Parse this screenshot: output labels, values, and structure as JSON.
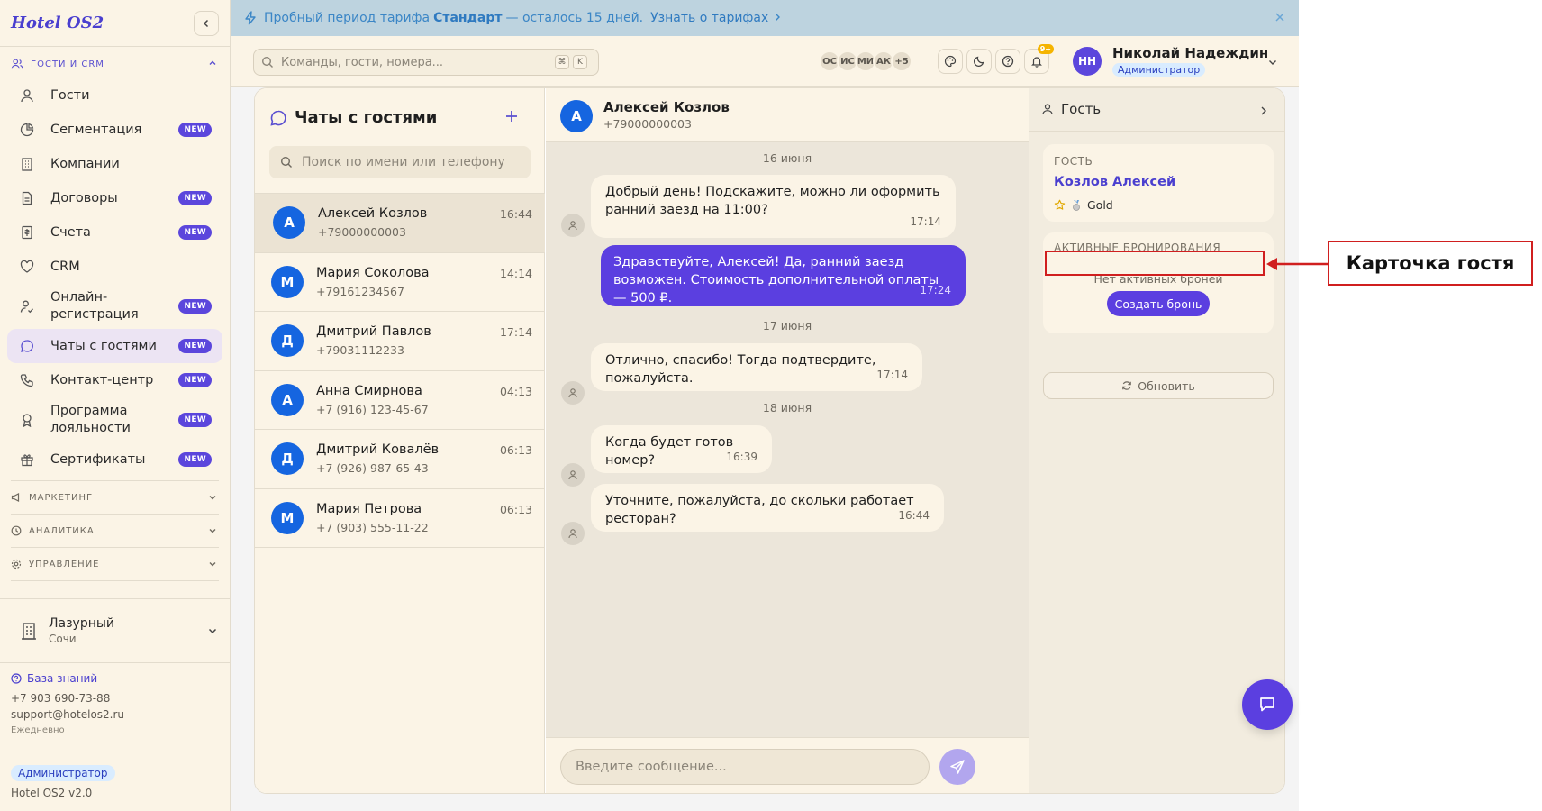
{
  "brand": "Hotel OS2",
  "sidebar": {
    "section_guests": "ГОСТИ И CRM",
    "items": [
      {
        "label": "Гости",
        "icon": "users-icon",
        "new": false
      },
      {
        "label": "Сегментация",
        "icon": "pie-chart-icon",
        "new": true
      },
      {
        "label": "Компании",
        "icon": "building-icon",
        "new": false
      },
      {
        "label": "Договоры",
        "icon": "document-icon",
        "new": true
      },
      {
        "label": "Счета",
        "icon": "invoice-icon",
        "new": true
      },
      {
        "label": "CRM",
        "icon": "heart-icon",
        "new": false
      },
      {
        "label": "Онлайн-регистрация",
        "icon": "user-check-icon",
        "new": true
      },
      {
        "label": "Чаты с гостями",
        "icon": "chat-icon",
        "new": true,
        "active": true
      },
      {
        "label": "Контакт-центр",
        "icon": "phone-icon",
        "new": true
      },
      {
        "label": "Программа лояльности",
        "icon": "award-icon",
        "new": true
      },
      {
        "label": "Сертификаты",
        "icon": "gift-icon",
        "new": true
      }
    ],
    "new_badge": "NEW",
    "section_marketing": "МАРКЕТИНГ",
    "section_analytics": "АНАЛИТИКА",
    "section_management": "УПРАВЛЕНИЕ",
    "hotel_name": "Лазурный",
    "hotel_city": "Сочи",
    "kb_link": "База знаний",
    "phone": "+7 903 690-73-88",
    "email": "support@hotelos2.ru",
    "schedule": "Ежедневно",
    "role": "Администратор",
    "version": "Hotel OS2 v2.0"
  },
  "banner": {
    "text_before": "Пробный период тарифа",
    "plan": "Стандарт",
    "text_after": "— осталось 15 дней.",
    "link": "Узнать о тарифах"
  },
  "header": {
    "search_placeholder": "Команды, гости, номера...",
    "kbd1": "⌘",
    "kbd2": "K",
    "presence": [
      "ОС",
      "ИС",
      "МИ",
      "АК",
      "+5"
    ],
    "notif_count": "9+",
    "user_initials": "НН",
    "user_name": "Николай Надеждин",
    "user_role": "Администратор"
  },
  "chat_list": {
    "title": "Чаты с гостями",
    "search_placeholder": "Поиск по имени или телефону",
    "chats": [
      {
        "initial": "А",
        "name": "Алексей Козлов",
        "phone": "+79000000003",
        "time": "16:44",
        "active": true
      },
      {
        "initial": "М",
        "name": "Мария Соколова",
        "phone": "+79161234567",
        "time": "14:14"
      },
      {
        "initial": "Д",
        "name": "Дмитрий Павлов",
        "phone": "+79031112233",
        "time": "17:14"
      },
      {
        "initial": "А",
        "name": "Анна Смирнова",
        "phone": "+7 (916) 123-45-67",
        "time": "04:13"
      },
      {
        "initial": "Д",
        "name": "Дмитрий Ковалёв",
        "phone": "+7 (926) 987-65-43",
        "time": "06:13"
      },
      {
        "initial": "М",
        "name": "Мария Петрова",
        "phone": "+7 (903) 555-11-22",
        "time": "06:13"
      }
    ]
  },
  "conversation": {
    "initial": "А",
    "name": "Алексей Козлов",
    "phone": "+79000000003",
    "dates": [
      "16 июня",
      "17 июня",
      "18 июня"
    ],
    "messages": [
      {
        "text": "Добрый день! Подскажите, можно ли оформить ранний заезд на 11:00?",
        "time": "17:14",
        "dir": "in"
      },
      {
        "text": "Здравствуйте, Алексей! Да, ранний заезд возможен. Стоимость дополнительной оплаты — 500 ₽.",
        "time": "17:24",
        "dir": "out"
      },
      {
        "text": "Отлично, спасибо! Тогда подтвердите, пожалуйста.",
        "time": "17:14",
        "dir": "in"
      },
      {
        "text": "Когда будет готов номер?",
        "time": "16:39",
        "dir": "in"
      },
      {
        "text": "Уточните, пожалуйста, до скольки работает ресторан?",
        "time": "16:44",
        "dir": "in"
      }
    ],
    "input_placeholder": "Введите сообщение..."
  },
  "guest_panel": {
    "title": "Гость",
    "label_guest": "ГОСТЬ",
    "guest_name": "Козлов Алексей",
    "tier": "Gold",
    "label_bookings": "АКТИВНЫЕ БРОНИРОВАНИЯ",
    "no_bookings": "Нет активных броней",
    "create_button": "Создать бронь",
    "refresh_button": "Обновить"
  },
  "annotation": {
    "callout": "Карточка гостя",
    "color": "#d01f1f"
  }
}
